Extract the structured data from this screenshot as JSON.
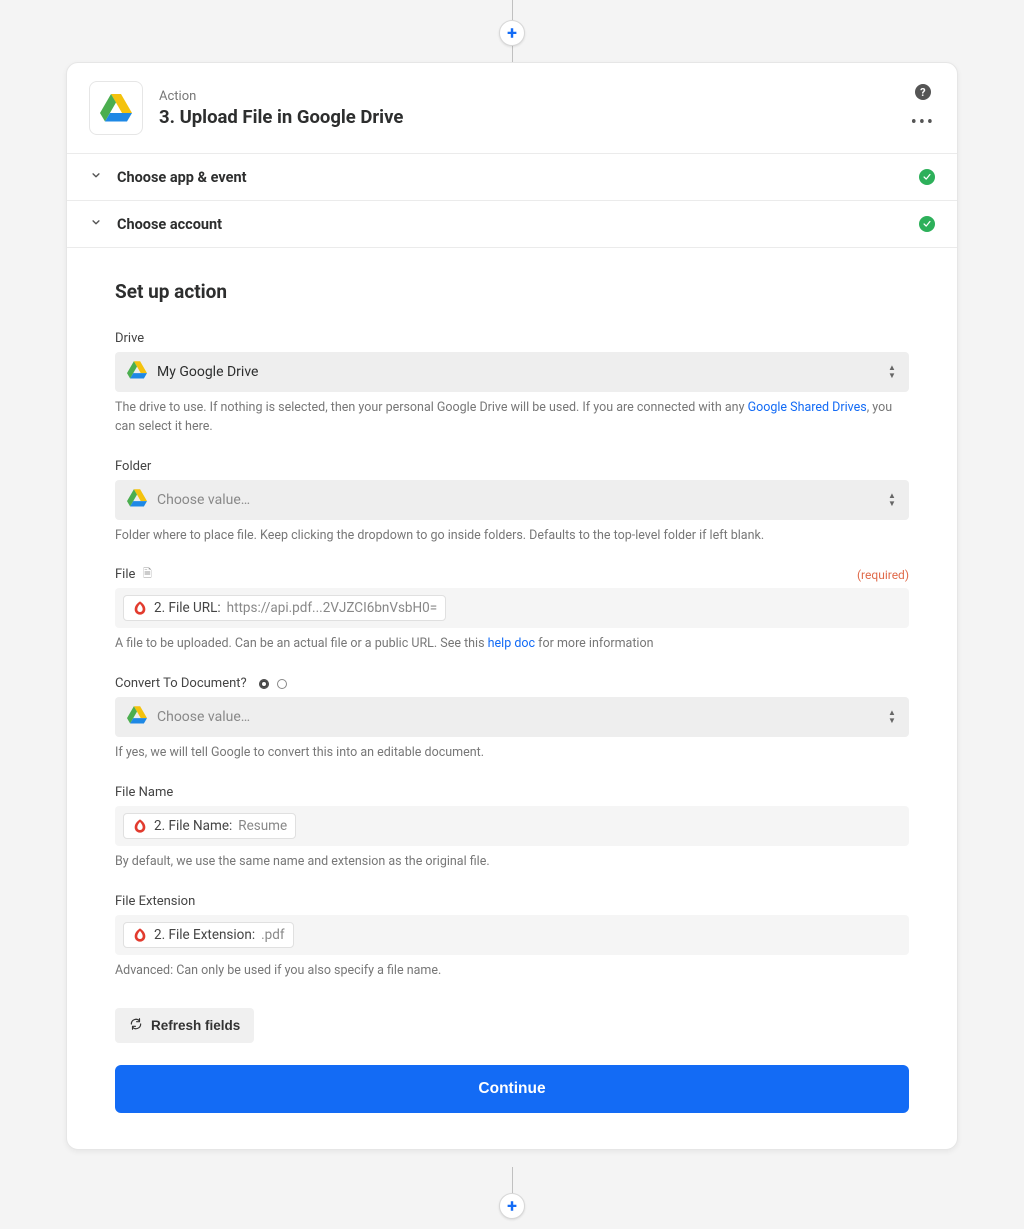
{
  "header": {
    "type_label": "Action",
    "title": "3. Upload File in Google Drive"
  },
  "sections": {
    "choose_app": "Choose app & event",
    "choose_account": "Choose account"
  },
  "panel": {
    "title": "Set up action",
    "fields": {
      "drive": {
        "label": "Drive",
        "value": "My Google Drive",
        "help_pre": "The drive to use. If nothing is selected, then your personal Google Drive will be used. If you are connected with any ",
        "help_link": "Google Shared Drives",
        "help_post": ", you can select it here."
      },
      "folder": {
        "label": "Folder",
        "placeholder": "Choose value…",
        "help": "Folder where to place file. Keep clicking the dropdown to go inside folders. Defaults to the top-level folder if left blank."
      },
      "file": {
        "label": "File",
        "required": "(required)",
        "pill_label": "2. File URL:",
        "pill_value": "https://api.pdf...2VJZCI6bnVsbH0=",
        "help_pre": "A file to be uploaded. Can be an actual file or a public URL. See this ",
        "help_link": "help doc",
        "help_post": " for more information"
      },
      "convert": {
        "label": "Convert To Document?",
        "placeholder": "Choose value…",
        "help": "If yes, we will tell Google to convert this into an editable document."
      },
      "filename": {
        "label": "File Name",
        "pill_label": "2. File Name:",
        "pill_value": "Resume",
        "help": "By default, we use the same name and extension as the original file."
      },
      "fileext": {
        "label": "File Extension",
        "pill_label": "2. File Extension:",
        "pill_value": ".pdf",
        "help": "Advanced: Can only be used if you also specify a file name."
      }
    },
    "refresh": "Refresh fields",
    "continue": "Continue"
  }
}
